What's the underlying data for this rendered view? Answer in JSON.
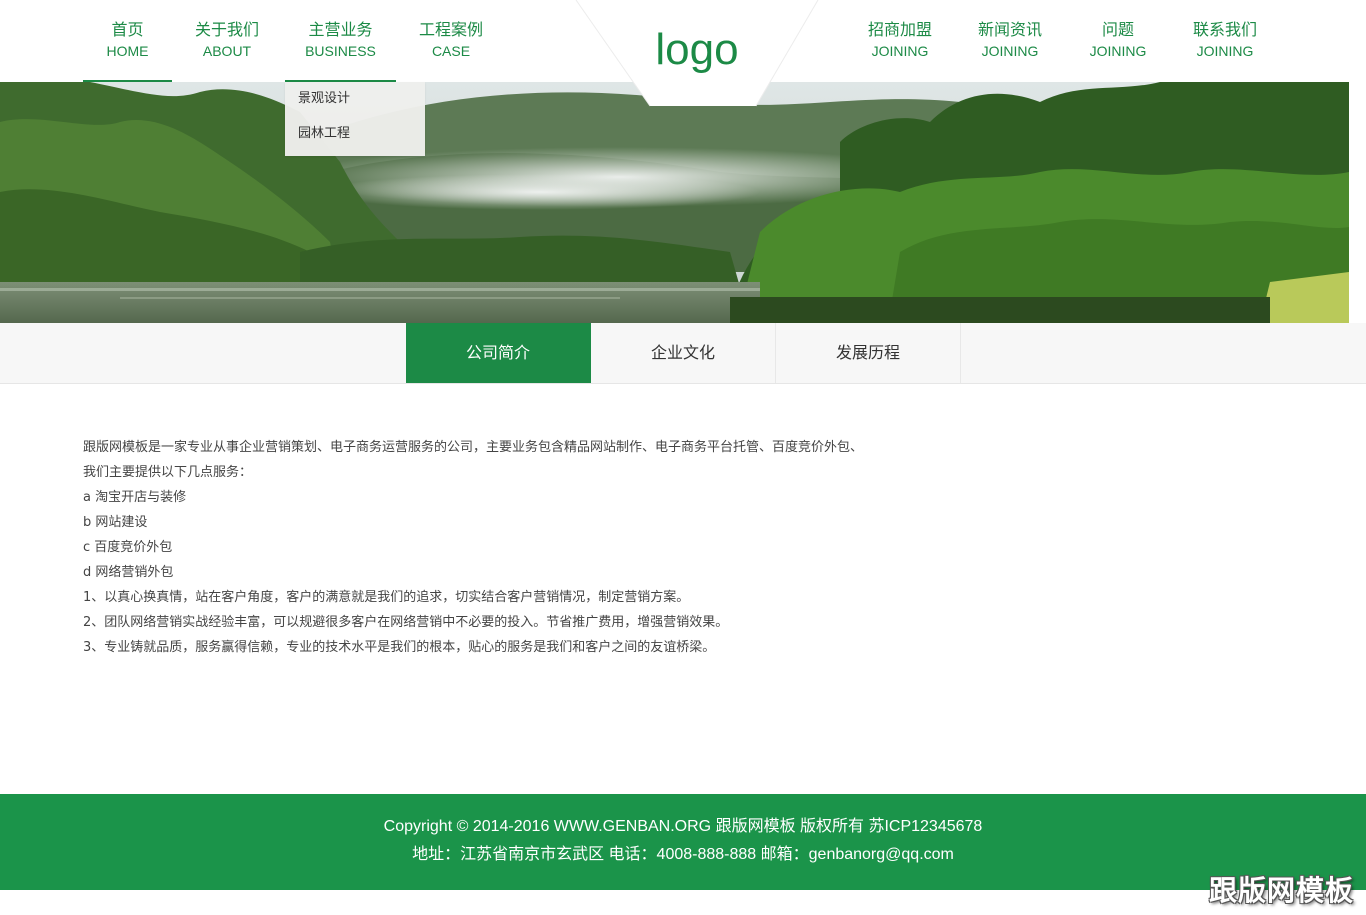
{
  "header": {
    "logo": "logo",
    "nav_left": [
      {
        "cn": "首页",
        "en": "HOME"
      },
      {
        "cn": "关于我们",
        "en": "ABOUT"
      },
      {
        "cn": "主营业务",
        "en": "BUSINESS"
      },
      {
        "cn": "工程案例",
        "en": "CASE"
      }
    ],
    "nav_right": [
      {
        "cn": "招商加盟",
        "en": "JOINING"
      },
      {
        "cn": "新闻资讯",
        "en": "JOINING"
      },
      {
        "cn": "问题",
        "en": "JOINING"
      },
      {
        "cn": "联系我们",
        "en": "JOINING"
      }
    ],
    "dropdown": [
      "景观设计",
      "园林工程"
    ]
  },
  "tabs": [
    "公司简介",
    "企业文化",
    "发展历程"
  ],
  "content": [
    "跟版网模板是一家专业从事企业营销策划、电子商务运营服务的公司，主要业务包含精品网站制作、电子商务平台托管、百度竞价外包、",
    "我们主要提供以下几点服务：",
    "a  淘宝开店与装修",
    "b  网站建设",
    "c  百度竞价外包",
    "d  网络营销外包",
    "1、以真心换真情，站在客户角度，客户的满意就是我们的追求，切实结合客户营销情况，制定营销方案。",
    "2、团队网络营销实战经验丰富，可以规避很多客户在网络营销中不必要的投入。节省推广费用，增强营销效果。",
    "3、专业铸就品质，服务赢得信赖，专业的技术水平是我们的根本，贴心的服务是我们和客户之间的友谊桥梁。"
  ],
  "footer": {
    "line1": "Copyright © 2014-2016 WWW.GENBAN.ORG 跟版网模板 版权所有    苏ICP12345678",
    "line2": "地址：江苏省南京市玄武区    电话：4008-888-888    邮箱：genbanorg@qq.com"
  },
  "watermark": "跟版网模板",
  "colors": {
    "accent": "#1c8a46",
    "footer_bg": "#1b944a",
    "tab_bar_bg": "#f7f7f7"
  }
}
